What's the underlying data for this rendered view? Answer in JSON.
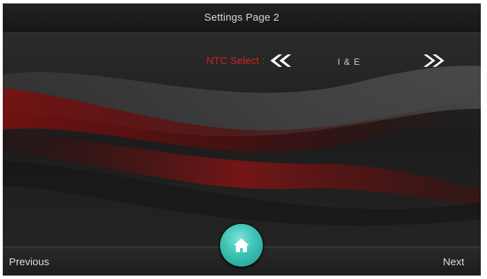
{
  "header": {
    "title": "Settings Page 2"
  },
  "setting": {
    "label": "NTC Select :",
    "value": "I & E",
    "decrease_icon": "double-chevron-left-icon",
    "increase_icon": "double-chevron-right-icon"
  },
  "footer": {
    "previous_label": "Previous",
    "next_label": "Next",
    "home_icon": "home-icon"
  },
  "colors": {
    "accent_red": "#d61f1f",
    "home_teal": "#3cc2b3",
    "background": "#1f1f1f"
  }
}
